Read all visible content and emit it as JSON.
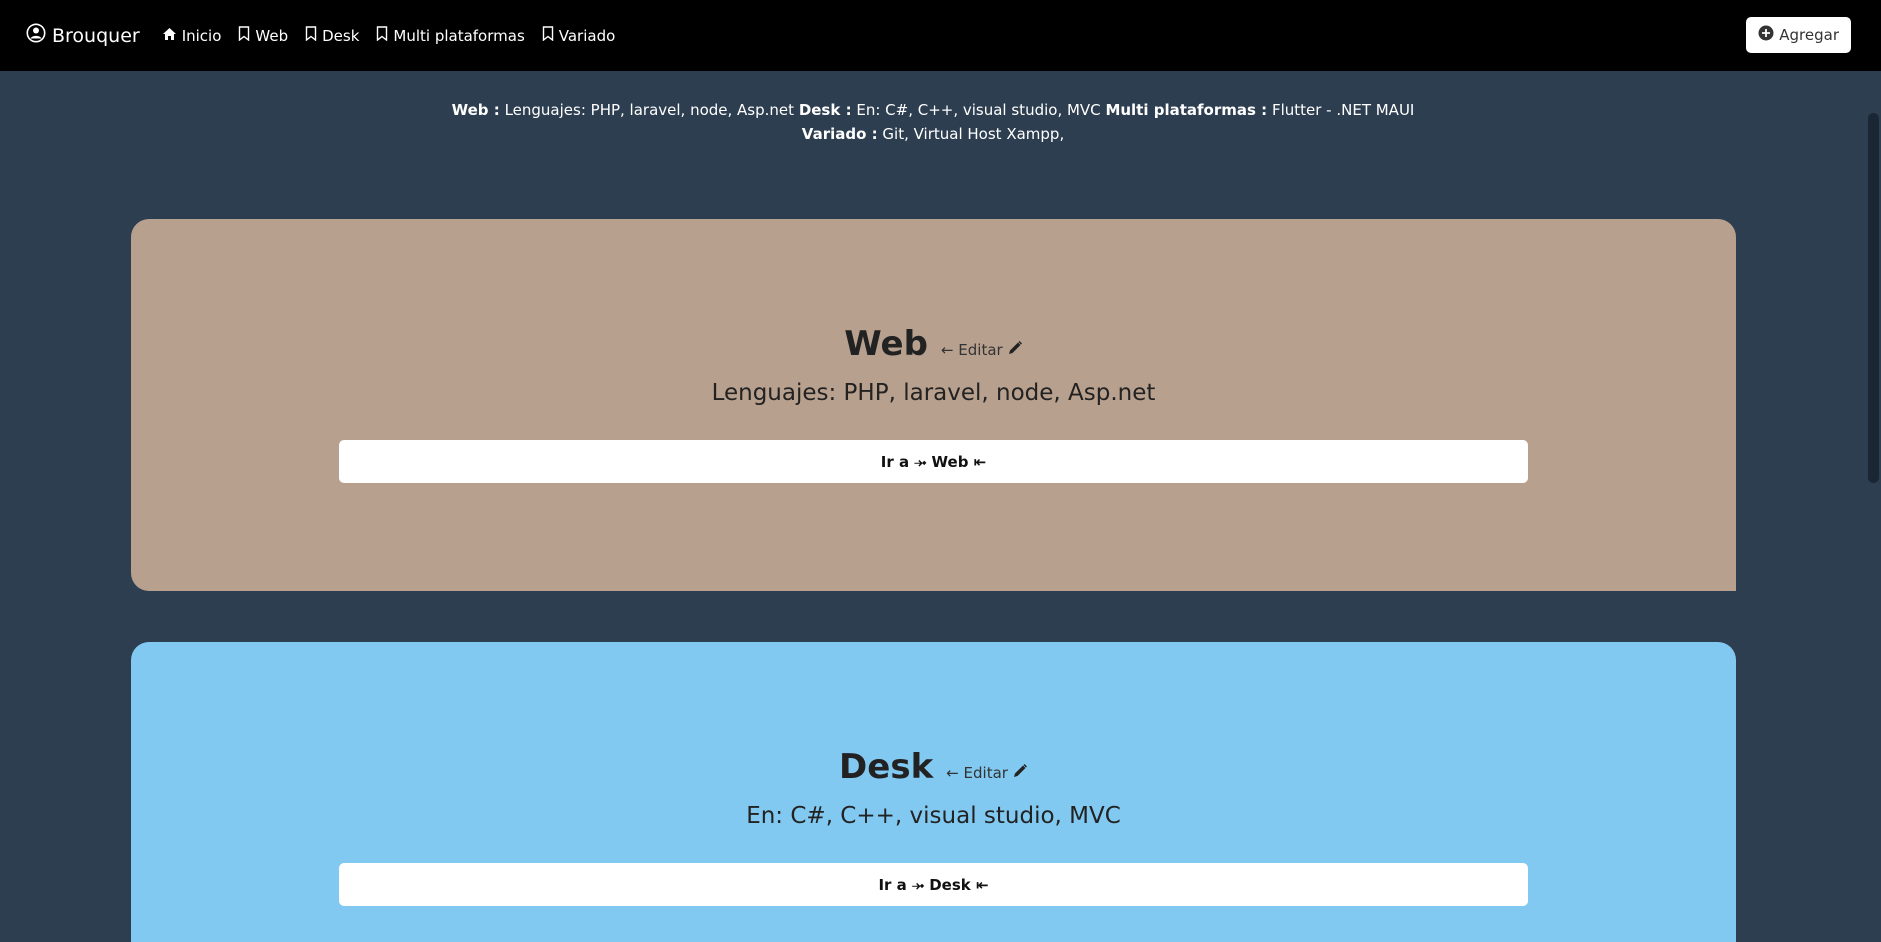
{
  "navbar": {
    "brand": "Brouquer",
    "links": [
      "Inicio",
      "Web",
      "Desk",
      "Multi plataformas",
      "Variado"
    ],
    "add_label": "Agregar"
  },
  "summary": {
    "web_label": "Web :",
    "web_text": "Lenguajes: PHP, laravel, node, Asp.net",
    "desk_label": "Desk :",
    "desk_text": "En: C#, C++, visual studio, MVC",
    "multi_label": "Multi plataformas :",
    "multi_text": "Flutter - .NET MAUI",
    "variado_label": "Variado :",
    "variado_text": "Git, Virtual Host Xampp,"
  },
  "cards": [
    {
      "title": "Web",
      "edit_label": "← Editar",
      "description": "Lenguajes: PHP, laravel, node, Asp.net",
      "button_label": "Ir a ⤞ Web ⇤",
      "color": "#b8a08e"
    },
    {
      "title": "Desk",
      "edit_label": "← Editar",
      "description": "En: C#, C++, visual studio, MVC",
      "button_label": "Ir a ⤞ Desk ⇤",
      "color": "#82c9f2"
    }
  ],
  "icons": {
    "brand": "person-circle-icon",
    "inicio": "house-icon",
    "categories": "bookmark-icon",
    "add": "plus-circle-icon",
    "edit": "pencil-icon"
  }
}
